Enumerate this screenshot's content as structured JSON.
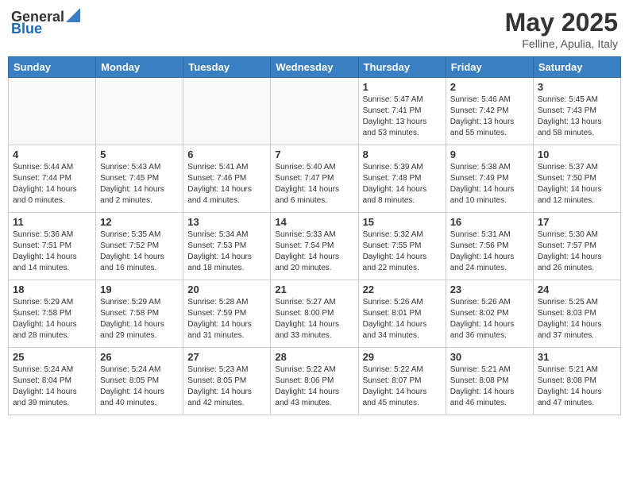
{
  "header": {
    "logo_general": "General",
    "logo_blue": "Blue",
    "month": "May 2025",
    "location": "Felline, Apulia, Italy"
  },
  "days_of_week": [
    "Sunday",
    "Monday",
    "Tuesday",
    "Wednesday",
    "Thursday",
    "Friday",
    "Saturday"
  ],
  "weeks": [
    [
      {
        "day": "",
        "info": "",
        "empty": true
      },
      {
        "day": "",
        "info": "",
        "empty": true
      },
      {
        "day": "",
        "info": "",
        "empty": true
      },
      {
        "day": "",
        "info": "",
        "empty": true
      },
      {
        "day": "1",
        "info": "Sunrise: 5:47 AM\nSunset: 7:41 PM\nDaylight: 13 hours\nand 53 minutes."
      },
      {
        "day": "2",
        "info": "Sunrise: 5:46 AM\nSunset: 7:42 PM\nDaylight: 13 hours\nand 55 minutes."
      },
      {
        "day": "3",
        "info": "Sunrise: 5:45 AM\nSunset: 7:43 PM\nDaylight: 13 hours\nand 58 minutes."
      }
    ],
    [
      {
        "day": "4",
        "info": "Sunrise: 5:44 AM\nSunset: 7:44 PM\nDaylight: 14 hours\nand 0 minutes."
      },
      {
        "day": "5",
        "info": "Sunrise: 5:43 AM\nSunset: 7:45 PM\nDaylight: 14 hours\nand 2 minutes."
      },
      {
        "day": "6",
        "info": "Sunrise: 5:41 AM\nSunset: 7:46 PM\nDaylight: 14 hours\nand 4 minutes."
      },
      {
        "day": "7",
        "info": "Sunrise: 5:40 AM\nSunset: 7:47 PM\nDaylight: 14 hours\nand 6 minutes."
      },
      {
        "day": "8",
        "info": "Sunrise: 5:39 AM\nSunset: 7:48 PM\nDaylight: 14 hours\nand 8 minutes."
      },
      {
        "day": "9",
        "info": "Sunrise: 5:38 AM\nSunset: 7:49 PM\nDaylight: 14 hours\nand 10 minutes."
      },
      {
        "day": "10",
        "info": "Sunrise: 5:37 AM\nSunset: 7:50 PM\nDaylight: 14 hours\nand 12 minutes."
      }
    ],
    [
      {
        "day": "11",
        "info": "Sunrise: 5:36 AM\nSunset: 7:51 PM\nDaylight: 14 hours\nand 14 minutes."
      },
      {
        "day": "12",
        "info": "Sunrise: 5:35 AM\nSunset: 7:52 PM\nDaylight: 14 hours\nand 16 minutes."
      },
      {
        "day": "13",
        "info": "Sunrise: 5:34 AM\nSunset: 7:53 PM\nDaylight: 14 hours\nand 18 minutes."
      },
      {
        "day": "14",
        "info": "Sunrise: 5:33 AM\nSunset: 7:54 PM\nDaylight: 14 hours\nand 20 minutes."
      },
      {
        "day": "15",
        "info": "Sunrise: 5:32 AM\nSunset: 7:55 PM\nDaylight: 14 hours\nand 22 minutes."
      },
      {
        "day": "16",
        "info": "Sunrise: 5:31 AM\nSunset: 7:56 PM\nDaylight: 14 hours\nand 24 minutes."
      },
      {
        "day": "17",
        "info": "Sunrise: 5:30 AM\nSunset: 7:57 PM\nDaylight: 14 hours\nand 26 minutes."
      }
    ],
    [
      {
        "day": "18",
        "info": "Sunrise: 5:29 AM\nSunset: 7:58 PM\nDaylight: 14 hours\nand 28 minutes."
      },
      {
        "day": "19",
        "info": "Sunrise: 5:29 AM\nSunset: 7:58 PM\nDaylight: 14 hours\nand 29 minutes."
      },
      {
        "day": "20",
        "info": "Sunrise: 5:28 AM\nSunset: 7:59 PM\nDaylight: 14 hours\nand 31 minutes."
      },
      {
        "day": "21",
        "info": "Sunrise: 5:27 AM\nSunset: 8:00 PM\nDaylight: 14 hours\nand 33 minutes."
      },
      {
        "day": "22",
        "info": "Sunrise: 5:26 AM\nSunset: 8:01 PM\nDaylight: 14 hours\nand 34 minutes."
      },
      {
        "day": "23",
        "info": "Sunrise: 5:26 AM\nSunset: 8:02 PM\nDaylight: 14 hours\nand 36 minutes."
      },
      {
        "day": "24",
        "info": "Sunrise: 5:25 AM\nSunset: 8:03 PM\nDaylight: 14 hours\nand 37 minutes."
      }
    ],
    [
      {
        "day": "25",
        "info": "Sunrise: 5:24 AM\nSunset: 8:04 PM\nDaylight: 14 hours\nand 39 minutes."
      },
      {
        "day": "26",
        "info": "Sunrise: 5:24 AM\nSunset: 8:05 PM\nDaylight: 14 hours\nand 40 minutes."
      },
      {
        "day": "27",
        "info": "Sunrise: 5:23 AM\nSunset: 8:05 PM\nDaylight: 14 hours\nand 42 minutes."
      },
      {
        "day": "28",
        "info": "Sunrise: 5:22 AM\nSunset: 8:06 PM\nDaylight: 14 hours\nand 43 minutes."
      },
      {
        "day": "29",
        "info": "Sunrise: 5:22 AM\nSunset: 8:07 PM\nDaylight: 14 hours\nand 45 minutes."
      },
      {
        "day": "30",
        "info": "Sunrise: 5:21 AM\nSunset: 8:08 PM\nDaylight: 14 hours\nand 46 minutes."
      },
      {
        "day": "31",
        "info": "Sunrise: 5:21 AM\nSunset: 8:08 PM\nDaylight: 14 hours\nand 47 minutes."
      }
    ]
  ]
}
